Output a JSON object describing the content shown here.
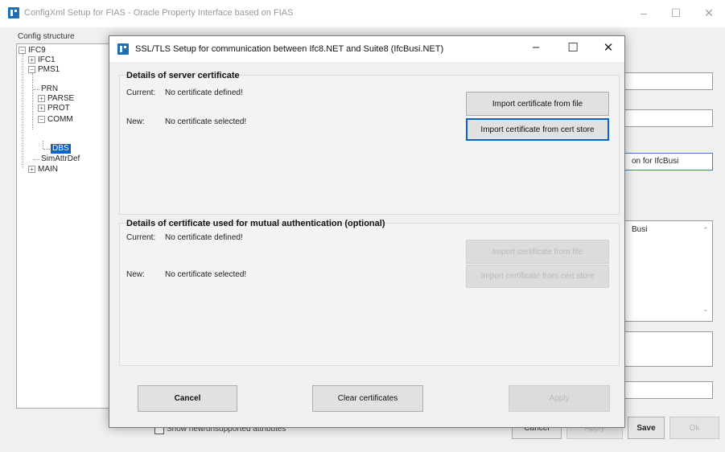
{
  "background_window": {
    "title": "ConfigXml Setup for FIAS - Oracle Property Interface based on FIAS",
    "controls": {
      "minimize": "–",
      "maximize": "☐",
      "close": "✕"
    },
    "tree_label": "Config structure",
    "tree": [
      {
        "label": "IFC9",
        "expander": "⊟"
      },
      {
        "label": "IFC1",
        "expander": "⊞"
      },
      {
        "label": "PMS1",
        "expander": "⊟"
      },
      {
        "label": "PRN"
      },
      {
        "label": "PARSE",
        "expander": "⊞"
      },
      {
        "label": "PROT",
        "expander": "⊞"
      },
      {
        "label": "COMM",
        "expander": "⊟"
      },
      {
        "label": "DBS"
      },
      {
        "label": "SimAttrDef"
      },
      {
        "label": "MAIN",
        "expander": "⊞"
      }
    ],
    "right_field_text": "on for IfcBusi",
    "right_list_text": "Busi",
    "show_new_unsupported_label": "Show new/unsupported attributes",
    "buttons": {
      "cancel": "Cancel",
      "apply": "Apply",
      "save": "Save",
      "ok": "Ok"
    }
  },
  "dialog": {
    "title": "SSL/TLS Setup for communication between Ifc8.NET and Suite8 (IfcBusi.NET)",
    "controls": {
      "minimize": "–",
      "maximize": "☐",
      "close": "✕"
    },
    "server_group": {
      "title": "Details of server certificate",
      "current_label": "Current:",
      "current_value": "No certificate defined!",
      "new_label": "New:",
      "new_value": "No certificate selected!",
      "import_file_button": "Import certificate from file",
      "import_store_button": "Import certificate from cert store"
    },
    "mutual_group": {
      "title": "Details of certificate used for mutual authentication (optional)",
      "current_label": "Current:",
      "current_value": "No certificate defined!",
      "new_label": "New:",
      "new_value": "No certificate selected!",
      "import_file_button": "Import certificate from file",
      "import_store_button": "Import certificate from cert store"
    },
    "buttons": {
      "cancel": "Cancel",
      "clear": "Clear certificates",
      "apply": "Apply"
    }
  },
  "colors": {
    "accent": "#0a63c9",
    "app_icon": "#1f6fb7",
    "disabled_text": "#b9b9b9"
  }
}
